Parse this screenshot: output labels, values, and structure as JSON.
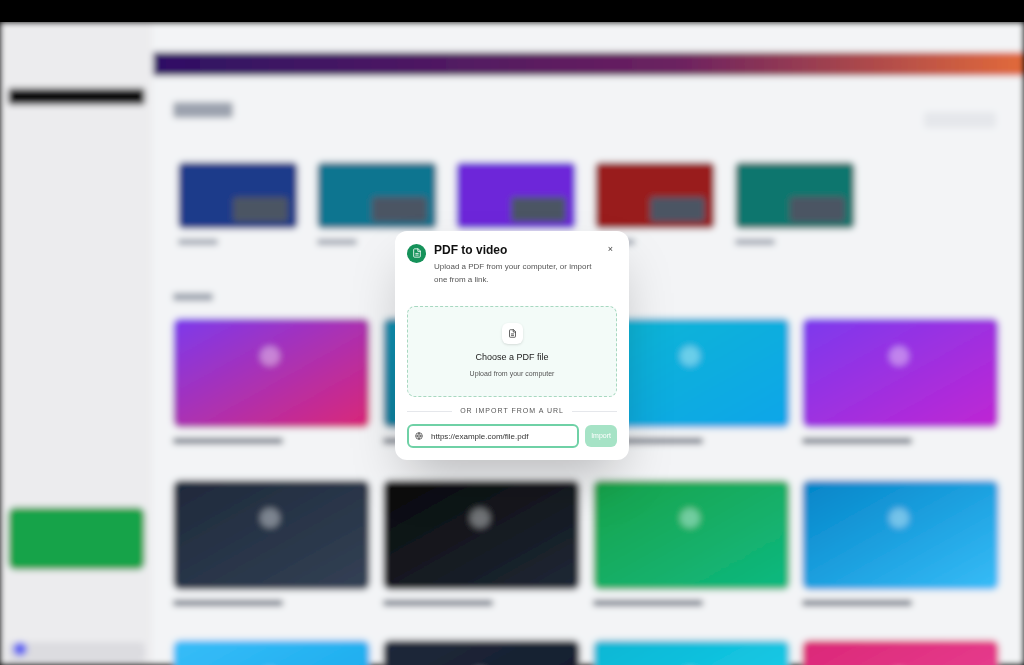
{
  "dialog": {
    "title": "PDF to video",
    "description": "Upload a PDF from your computer, or import one from a link.",
    "close": "×",
    "dropzone": {
      "title": "Choose a PDF file",
      "subtitle": "Upload from your computer"
    },
    "divider": "OR IMPORT FROM A URL",
    "url_field": {
      "value": "https://example.com/file.pdf",
      "focused": true
    },
    "import_button": {
      "label": "Import",
      "disabled": true
    }
  }
}
